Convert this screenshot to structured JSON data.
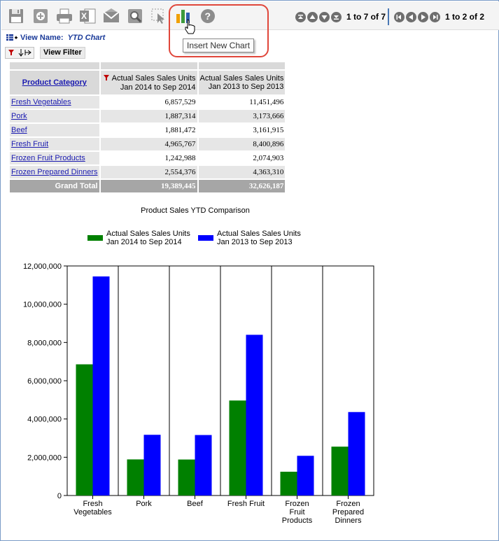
{
  "toolbar": {
    "icons": [
      "save-icon",
      "add-icon",
      "print-icon",
      "excel-icon",
      "email-icon",
      "search-icon",
      "select-icon",
      "insert-chart-icon",
      "help-icon"
    ],
    "tooltip": "Insert New Chart",
    "rows_paging": "1 to 7 of 7",
    "cols_paging": "1 to 2 of 2"
  },
  "view": {
    "label": "View Name:",
    "name": "YTD Chart",
    "filter_button": "View Filter"
  },
  "table": {
    "header_category": "Product Category",
    "header_m1_line1": "Actual Sales Sales Units",
    "header_m1_line2": "Jan 2014 to Sep 2014",
    "header_m2_line1": "Actual Sales Sales Units",
    "header_m2_line2": "Jan 2013 to Sep 2013",
    "rows": [
      {
        "category": "Fresh Vegetables",
        "v1": "6,857,529",
        "v2": "11,451,496"
      },
      {
        "category": "Pork",
        "v1": "1,887,314",
        "v2": "3,173,666"
      },
      {
        "category": "Beef",
        "v1": "1,881,472",
        "v2": "3,161,915"
      },
      {
        "category": "Fresh Fruit",
        "v1": "4,965,767",
        "v2": "8,400,896"
      },
      {
        "category": "Frozen Fruit Products",
        "v1": "1,242,988",
        "v2": "2,074,903"
      },
      {
        "category": "Frozen Prepared Dinners",
        "v1": "2,554,376",
        "v2": "4,363,310"
      }
    ],
    "grand_total_label": "Grand Total",
    "grand_total_v1": "19,389,445",
    "grand_total_v2": "32,626,187"
  },
  "chart_data": {
    "type": "bar",
    "title": "Product Sales YTD Comparison",
    "categories": [
      [
        "Fresh",
        "Vegetables"
      ],
      [
        "Pork"
      ],
      [
        "Beef"
      ],
      [
        "Fresh Fruit"
      ],
      [
        "Frozen",
        "Fruit",
        "Products"
      ],
      [
        "Frozen",
        "Prepared",
        "Dinners"
      ]
    ],
    "series": [
      {
        "name": [
          "Actual Sales Sales Units",
          "Jan 2014 to Sep 2014"
        ],
        "color": "#008000",
        "values": [
          6857529,
          1887314,
          1881472,
          4965767,
          1242988,
          2554376
        ]
      },
      {
        "name": [
          "Actual Sales Sales Units",
          "Jan 2013 to Sep 2013"
        ],
        "color": "#0000ff",
        "values": [
          11451496,
          3173666,
          3161915,
          8400896,
          2074903,
          4363310
        ]
      }
    ],
    "ylim": [
      0,
      12000000
    ],
    "yticks": [
      "0",
      "2,000,000",
      "4,000,000",
      "6,000,000",
      "8,000,000",
      "10,000,000",
      "12,000,000"
    ],
    "grid": "vertical separators",
    "legend": "top"
  }
}
